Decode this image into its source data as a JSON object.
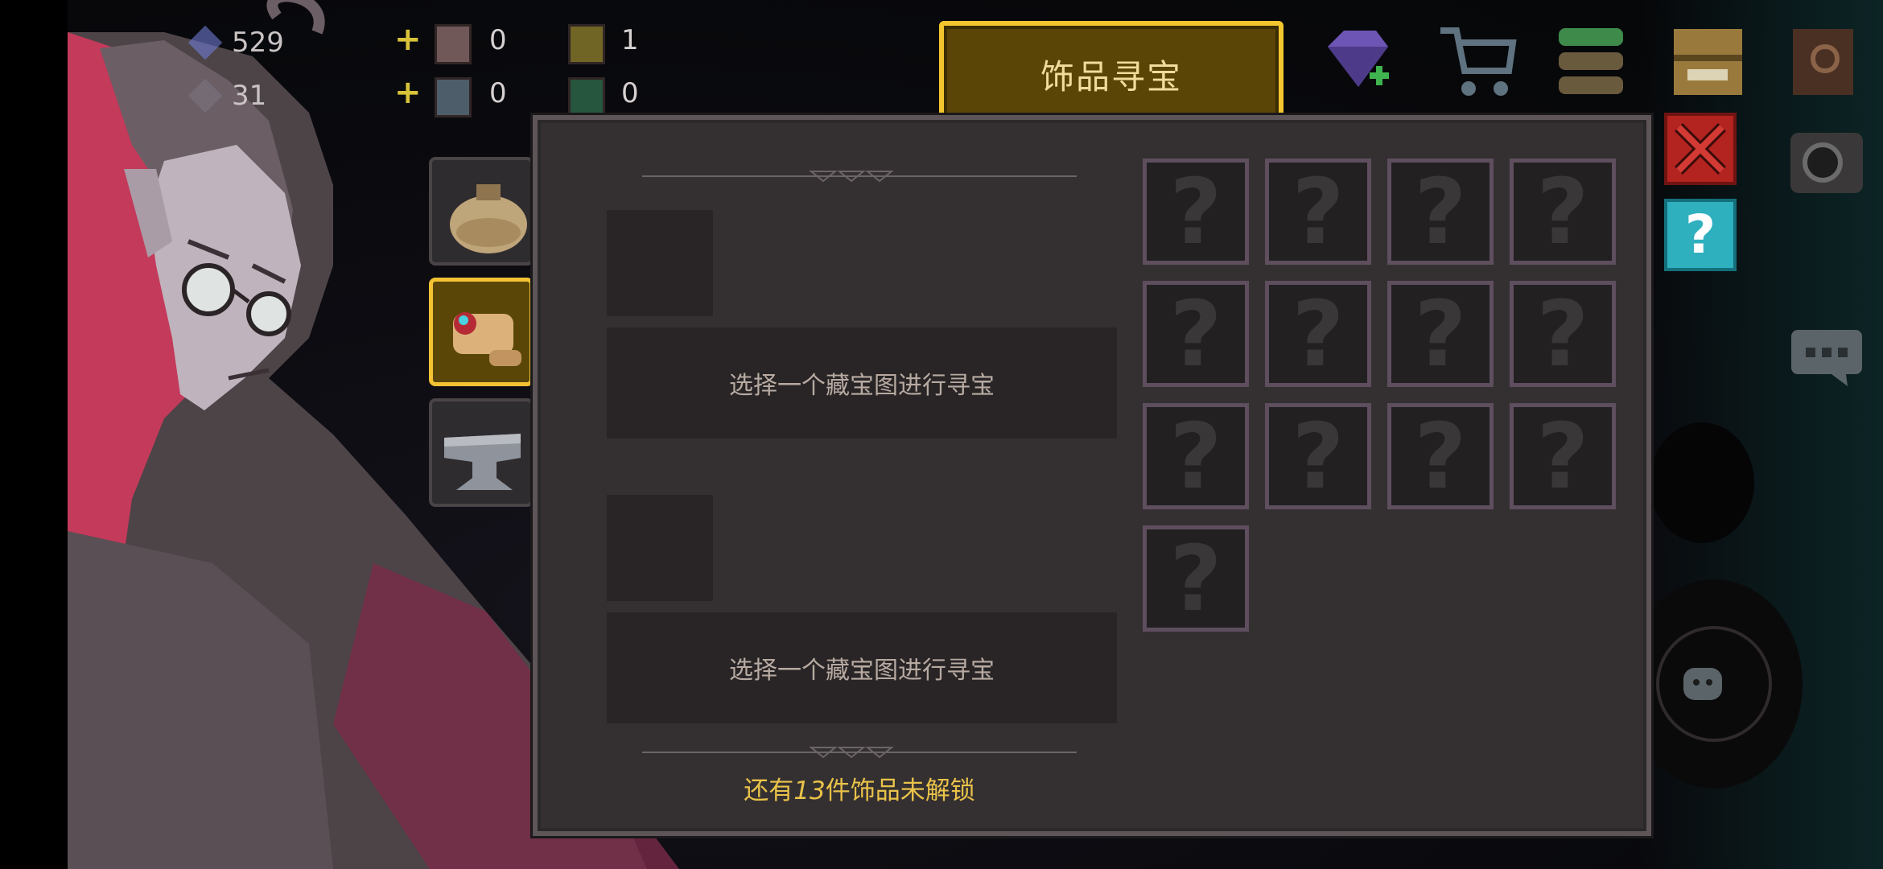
{
  "title": "饰品寻宝",
  "resources": {
    "row1": {
      "gem_value": "529",
      "item1_count": "0",
      "item2_count": "1"
    },
    "row2": {
      "gem_value": "31",
      "item1_count": "0",
      "item2_count": "0"
    }
  },
  "treasure_slots": [
    {
      "placeholder": "选择一个藏宝图进行寻宝"
    },
    {
      "placeholder": "选择一个藏宝图进行寻宝"
    }
  ],
  "locked_message": {
    "prefix": "还有",
    "count": "13",
    "suffix": "件饰品未解锁"
  },
  "accessory_grid": {
    "cell_symbol": "?",
    "cells": 13
  },
  "help_symbol": "?",
  "icons": {
    "side": [
      "bag-icon",
      "treasure-map-icon",
      "anvil-icon"
    ],
    "top_right": [
      "diamond-plus-icon",
      "shop-cart-icon",
      "stack-menu-icon",
      "chest-icon",
      "book-icon"
    ],
    "misc": [
      "close-icon",
      "help-icon",
      "camera-icon",
      "chat-icon"
    ]
  },
  "colors": {
    "accent_gold": "#f3c62f",
    "panel_bg": "#343031",
    "close_red": "#b3231f",
    "help_teal": "#2fb0bf",
    "locked_text": "#e9c24a"
  }
}
